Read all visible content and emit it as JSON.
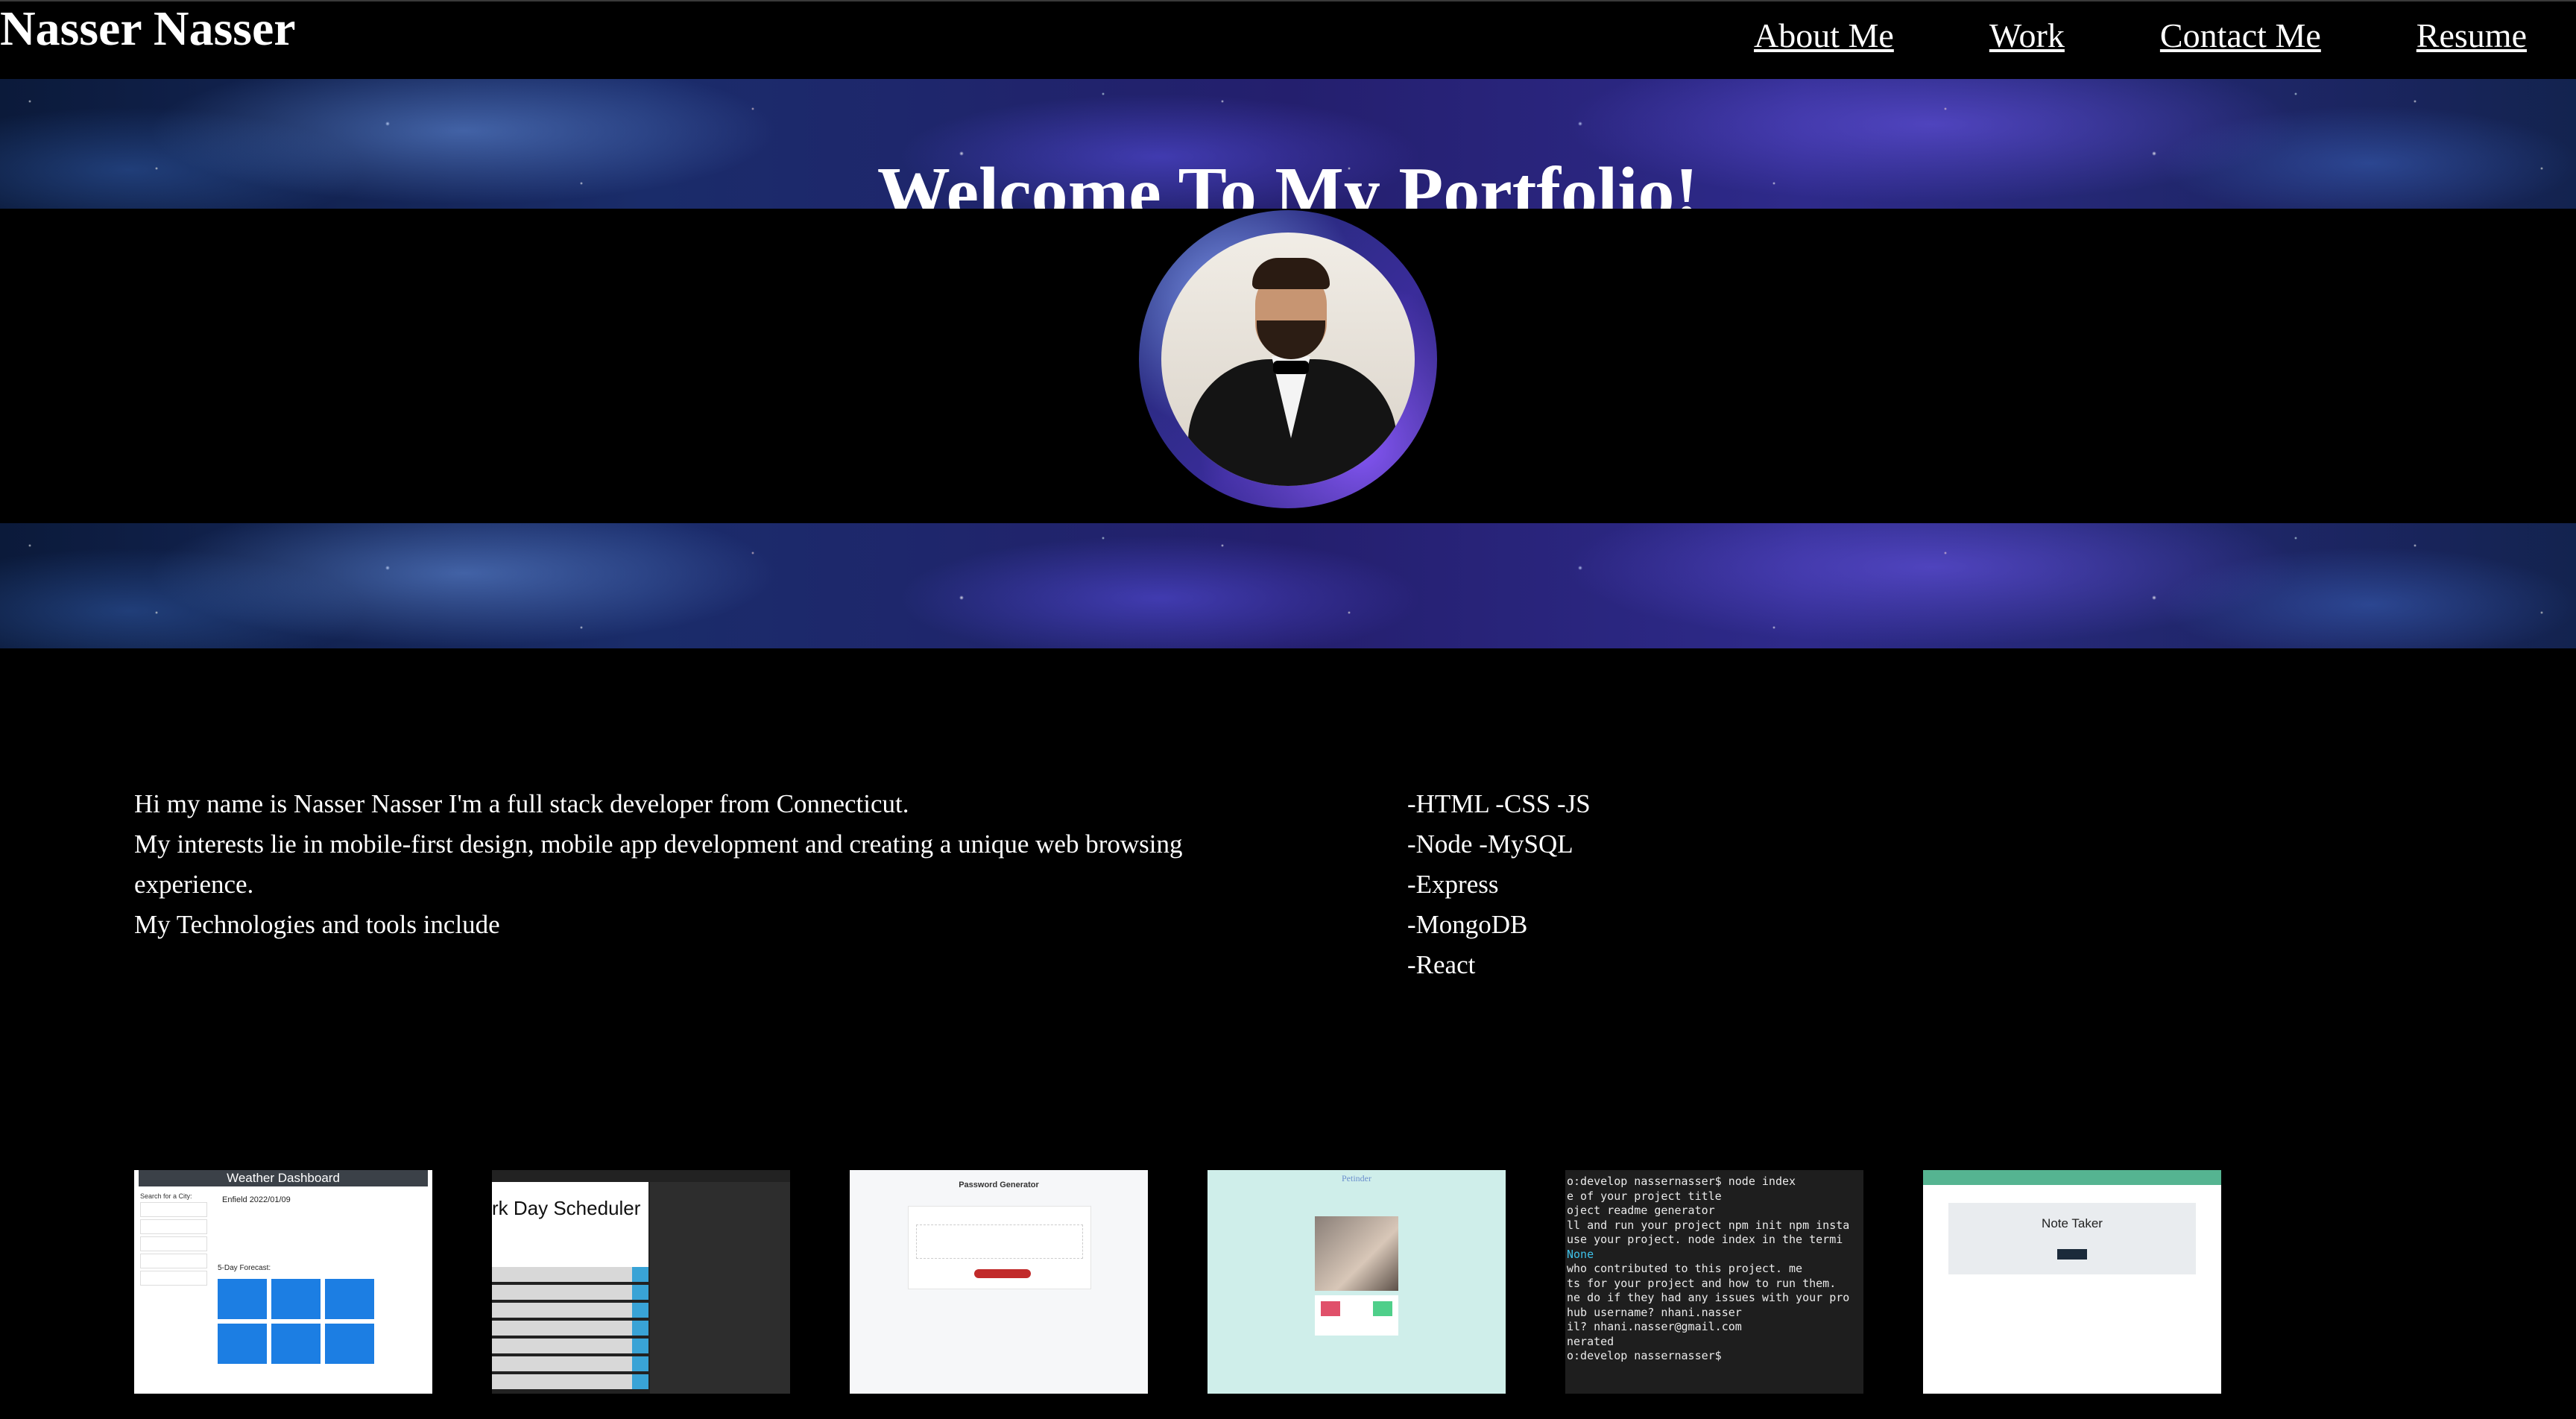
{
  "brand": "Nasser Nasser",
  "nav": [
    {
      "label": "About Me"
    },
    {
      "label": "Work"
    },
    {
      "label": "Contact Me"
    },
    {
      "label": "Resume"
    }
  ],
  "hero": {
    "title": "Welcome To My Portfolio!"
  },
  "about": {
    "lines": [
      "Hi my name is Nasser Nasser I'm a full stack developer from Connecticut.",
      "My interests lie in mobile-first design, mobile app development and creating a unique web browsing experience.",
      "My Technologies and tools include"
    ]
  },
  "skills": [
    "-HTML -CSS -JS",
    "-Node -MySQL",
    "-Express",
    "-MongoDB",
    "-React"
  ],
  "projects": {
    "weather": {
      "title": "Weather Dashboard",
      "search_label": "Search for a City:",
      "city": "Enfield 2022/01/09",
      "forecast": "5-Day Forecast:"
    },
    "scheduler": {
      "title": "rk Day Scheduler"
    },
    "password": {
      "title": "Password Generator"
    },
    "petinder": {
      "title": "Petinder"
    },
    "terminal": {
      "lines": [
        "o:develop nassernasser$ node index",
        "e of your project title",
        "oject readme generator",
        "ll and run your project npm init npm insta",
        "use your project. node index in the termi",
        "None",
        "who contributed to this project. me",
        "ts for your project and how to run them.",
        "ne do if they had any issues with your pro",
        "hub username? nhani.nasser",
        "il? nhani.nasser@gmail.com",
        "nerated",
        "o:develop nassernasser$ "
      ]
    },
    "note": {
      "title": "Note Taker"
    }
  }
}
